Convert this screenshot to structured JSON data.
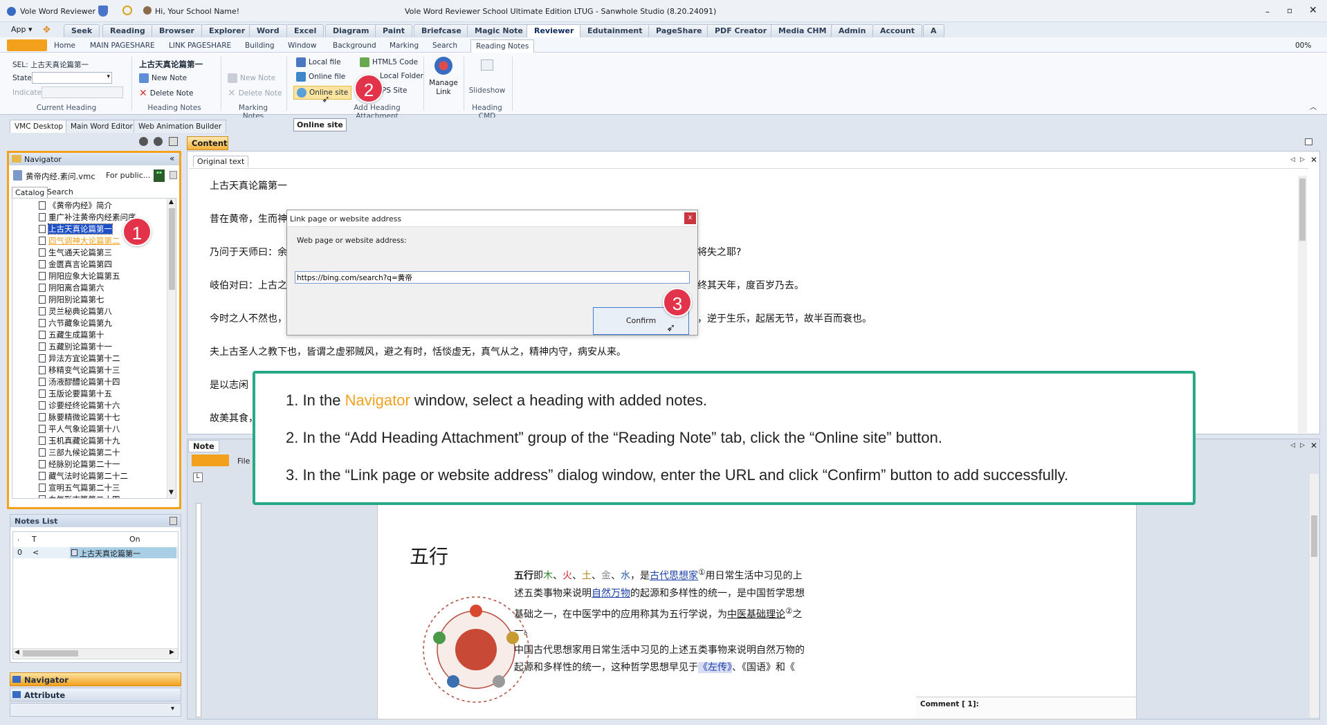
{
  "titlebar": {
    "app_name": "Vole Word Reviewer",
    "greeting": "Hi, Your School Name!",
    "title": "Vole Word Reviewer School Ultimate Edition LTUG - Sanwhole Studio (8.20.24091)"
  },
  "menu": {
    "app": "App",
    "tabs": [
      "Seek",
      "Reading",
      "Browser",
      "Explorer",
      "Word",
      "Excel",
      "Diagram",
      "Paint",
      "Briefcase",
      "Magic Note",
      "Reviewer",
      "Edutainment",
      "PageShare",
      "PDF Creator",
      "Media CHM",
      "Admin",
      "Account",
      "A"
    ],
    "active": "Reviewer",
    "zoom": "00%"
  },
  "subtabs": {
    "items": [
      "Home",
      "MAIN PAGESHARE",
      "LINK PAGESHARE",
      "Building",
      "Window",
      "Background",
      "Marking",
      "Search",
      "Reading Notes"
    ],
    "active": "Reading Notes"
  },
  "ribbon": {
    "sel_label": "SEL: 上古天真论篇第一",
    "state_label": "State",
    "indicate_label": "Indicate",
    "current_heading_group": "Current Heading",
    "heading_title": "上古天真论篇第一",
    "new_note": "New Note",
    "delete_note": "Delete Note",
    "heading_notes_group": "Heading Notes",
    "marking_new_note": "New Note",
    "marking_delete_note": "Delete Note",
    "marking_notes_group": "Marking Notes",
    "local_file": "Local file",
    "online_file": "Online file",
    "online_site": "Online site",
    "html5_code": "HTML5 Code",
    "local_folder": "Local Folder",
    "vps_site": "PS Site",
    "add_attachment_group": "Add Heading Attachment",
    "manage_link": "Manage Link",
    "slideshow": "Slideshow",
    "heading_cmd_group": "Heading CMD",
    "tooltip": "Online site"
  },
  "viewtabs": [
    "VMC Desktop",
    "Main Word Editor",
    "Web Animation Builder"
  ],
  "navigator": {
    "title": "Navigator",
    "file": "黄帝内经.素问.vmc",
    "file_desc": "For public...",
    "tabs": [
      "Catalog",
      "Search"
    ],
    "items": [
      "《黄帝内经》简介",
      "重广补注黄帝内经素问序",
      "上古天真论篇第一",
      "四气调神大论篇第二",
      "生气通天论篇第三",
      "金匮真言论篇第四",
      "阴阳应象大论篇第五",
      "阴阳离合篇第六",
      "阴阳别论篇第七",
      "灵兰秘典论篇第八",
      "六节藏象论篇第九",
      "五藏生成篇第十",
      "五藏别论篇第十一",
      "异法方宜论篇第十二",
      "移精变气论篇第十三",
      "汤液醪醴论篇第十四",
      "玉版论要篇第十五",
      "诊要经终论篇第十六",
      "脉要精微论篇第十七",
      "平人气象论篇第十八",
      "玉机真藏论篇第十九",
      "三部九候论篇第二十",
      "经脉别论篇第二十一",
      "藏气法时论篇第二十二",
      "宣明五气篇第二十三",
      "血气形志篇第二十四"
    ],
    "selected_index": 2
  },
  "notes_list": {
    "title": "Notes List",
    "headers": [
      "T",
      "On"
    ],
    "row_index": "0",
    "row_t": "<",
    "row_on": "上古天真论篇第一"
  },
  "bottom_panels": [
    "Navigator",
    "Attribute"
  ],
  "content": {
    "tab": "Content",
    "subtab": "Original text",
    "lines": [
      "上古天真论篇第一",
      "昔在黄帝，生而神",
      "乃问于天师曰：余",
      "岐伯对曰：上古之",
      "今时之人不然也，",
      "夫上古圣人之教下也，皆谓之虚邪贼风，避之有时，恬惔虚无，真气从之，精神内守，病安从来。",
      "是以志闲",
      "故美其食，"
    ],
    "right_fragments": [
      "将失之耶?",
      "终其天年，度百岁乃去。",
      "，逆于生乐，起居无节，故半百而衰也。"
    ]
  },
  "dialog": {
    "title": "Link page or website address",
    "label": "Web page or website address:",
    "url": "https://bing.com/search?q=黄帝",
    "confirm": "Confirm",
    "close": "x"
  },
  "callout": {
    "line1_pre": "1. In the ",
    "line1_hl": "Navigator",
    "line1_post": " window, select a heading with added notes.",
    "line2": "2. In the “Add Heading Attachment” group of the “Reading Note” tab, click the “Online site” button.",
    "line3": "3. In the “Link page or website address” dialog window, enter the URL and click “Confirm” button to add successfully.",
    "highlight_color": "#f3a11c"
  },
  "badges": [
    "1",
    "2",
    "3"
  ],
  "note": {
    "tab": "Note",
    "file": "File",
    "heading": "五行",
    "p1_bold": "五行",
    "p1_a": "即",
    "elements": [
      "木",
      "火",
      "土",
      "金",
      "水"
    ],
    "p1_b": "，是",
    "link1": "古代思想家",
    "sup1": "①",
    "p1_c": "用日常生活中习见的上",
    "p1_line2_a": "述五类事物来说明",
    "link2": "自然万物",
    "p1_line2_b": "的起源和多样性的统一，是中国哲学思想",
    "p1_line3_a": "基础之一，在中医学中的应用称其为五行学说，为",
    "link3": "中医基础理论",
    "sup2": "②",
    "p1_line3_b": "之",
    "p1_line4": "一。",
    "p2_line1": "中国古代思想家用日常生活中习见的上述五类事物来说明自然万物的",
    "p2_line2_a": "起源和多样性的统一，这种哲学思想早见于",
    "p2_line2_hl": "《左传》",
    "p2_line2_b": "、《国语》和《",
    "comment": "Comment [ 1]:"
  }
}
